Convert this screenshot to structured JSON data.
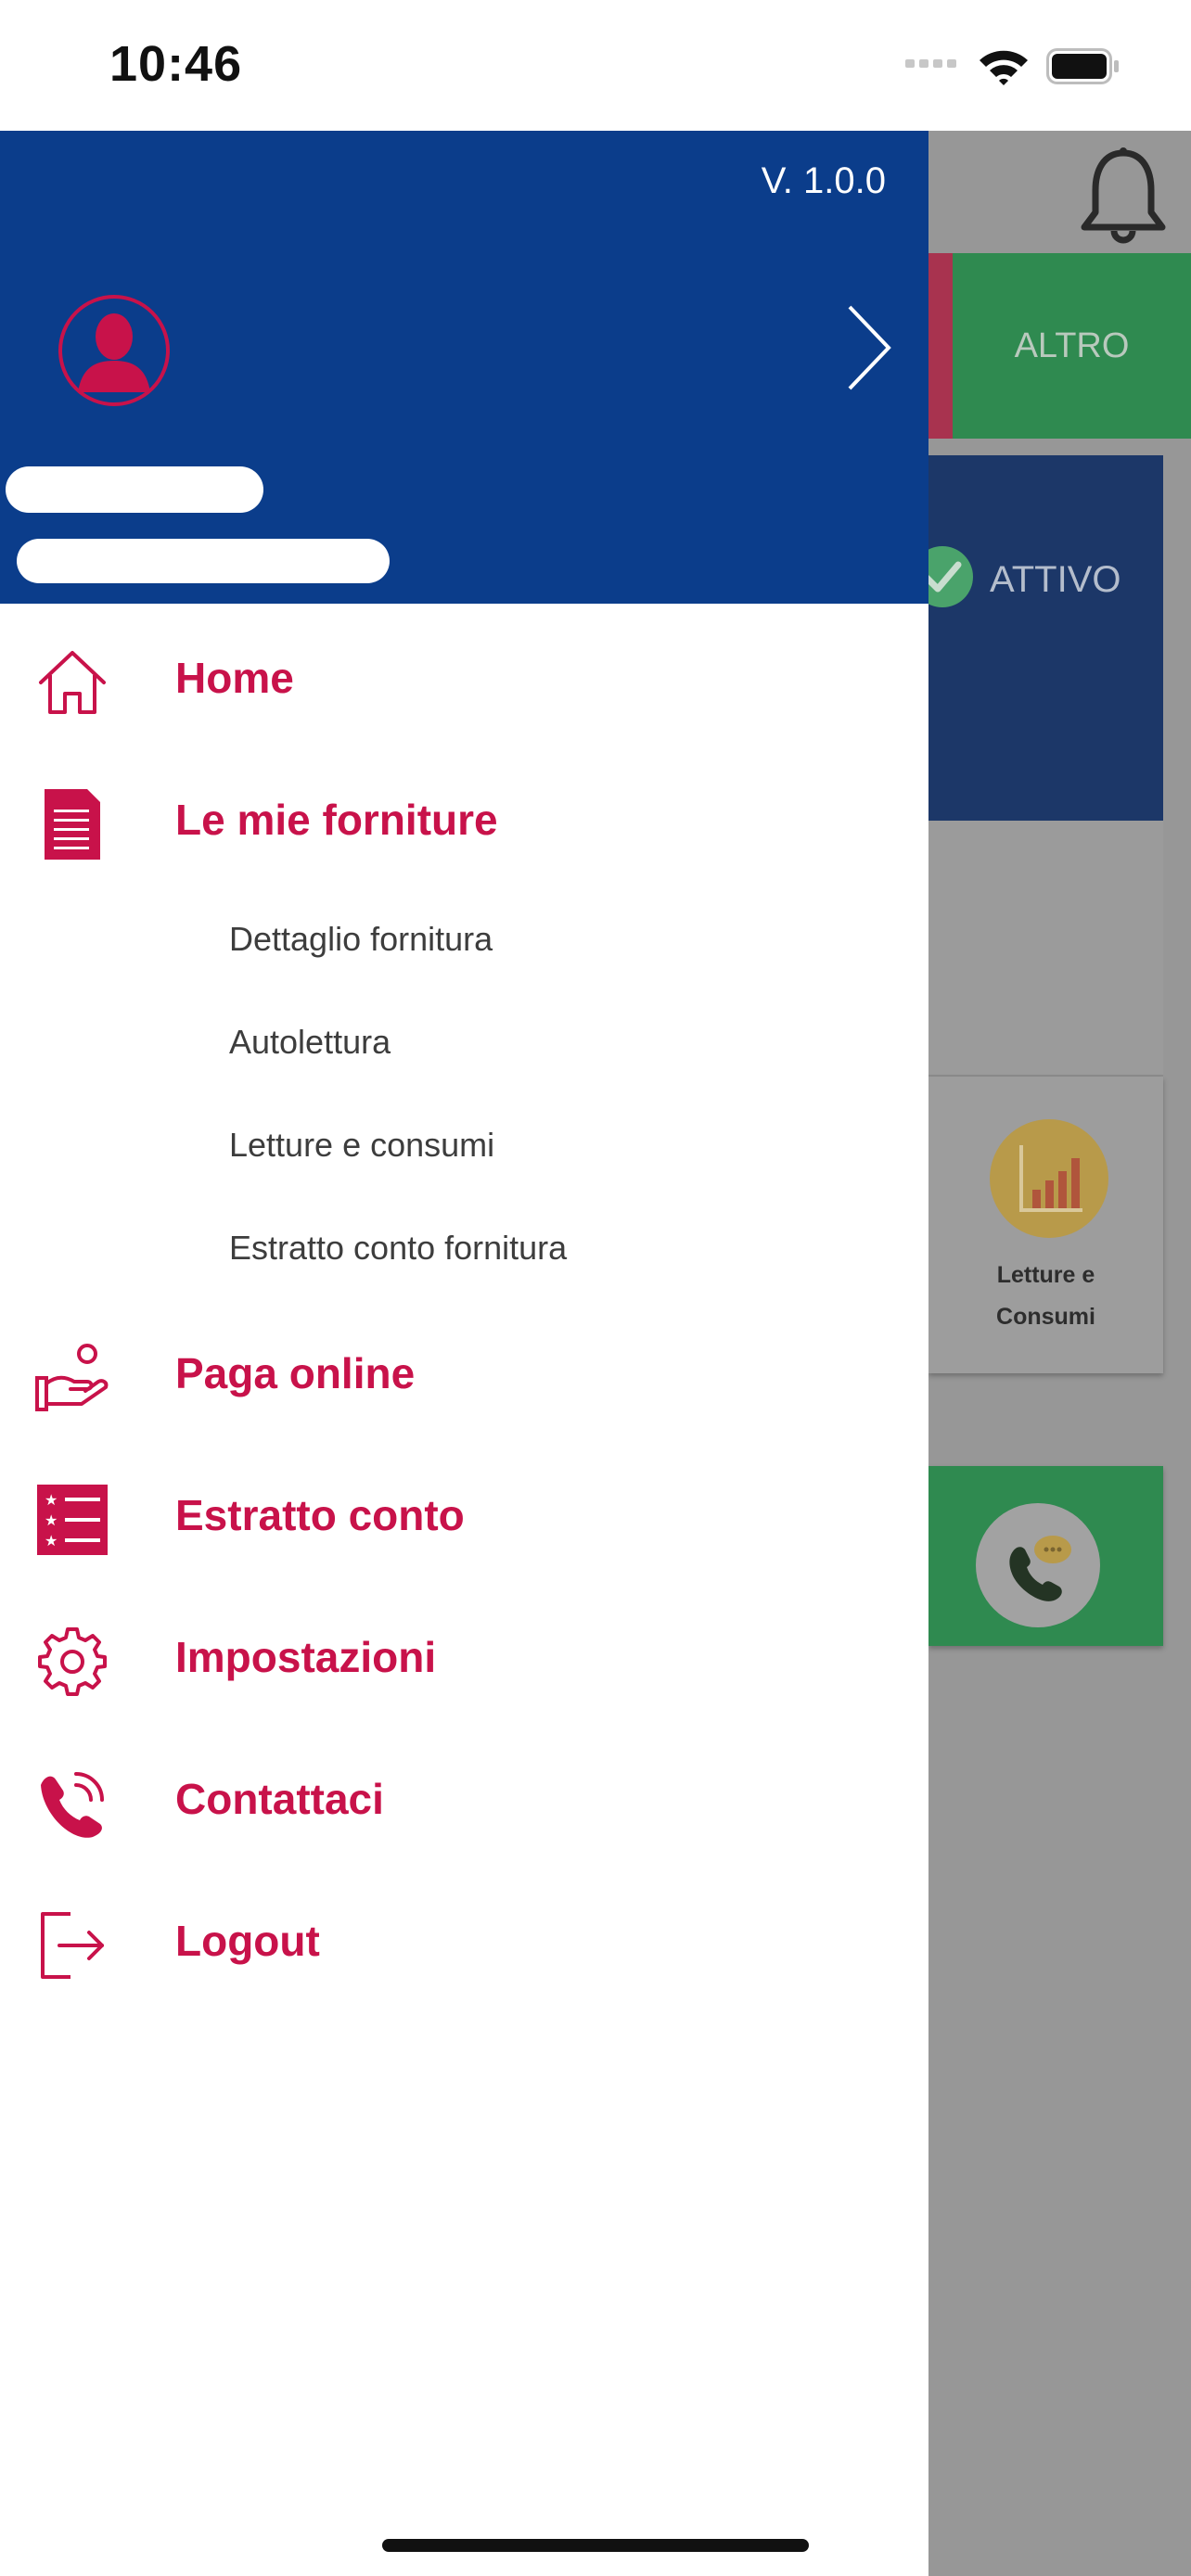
{
  "status_bar": {
    "time": "10:46"
  },
  "background_app": {
    "tab_label": "ALTRO",
    "status_label": "ATTIVO",
    "card_label": "Letture e\nConsumi"
  },
  "drawer": {
    "version": "V. 1.0.0",
    "menu": {
      "home": "Home",
      "forniture": "Le mie forniture",
      "sub": [
        "Dettaglio fornitura",
        "Autolettura",
        "Letture e consumi",
        "Estratto conto fornitura"
      ],
      "paga": "Paga online",
      "estratto": "Estratto conto",
      "impostazioni": "Impostazioni",
      "contattaci": "Contattaci",
      "logout": "Logout"
    }
  },
  "colors": {
    "header_blue": "#0b3d8b",
    "accent_red": "#c8124a",
    "green": "#2f8a50"
  }
}
